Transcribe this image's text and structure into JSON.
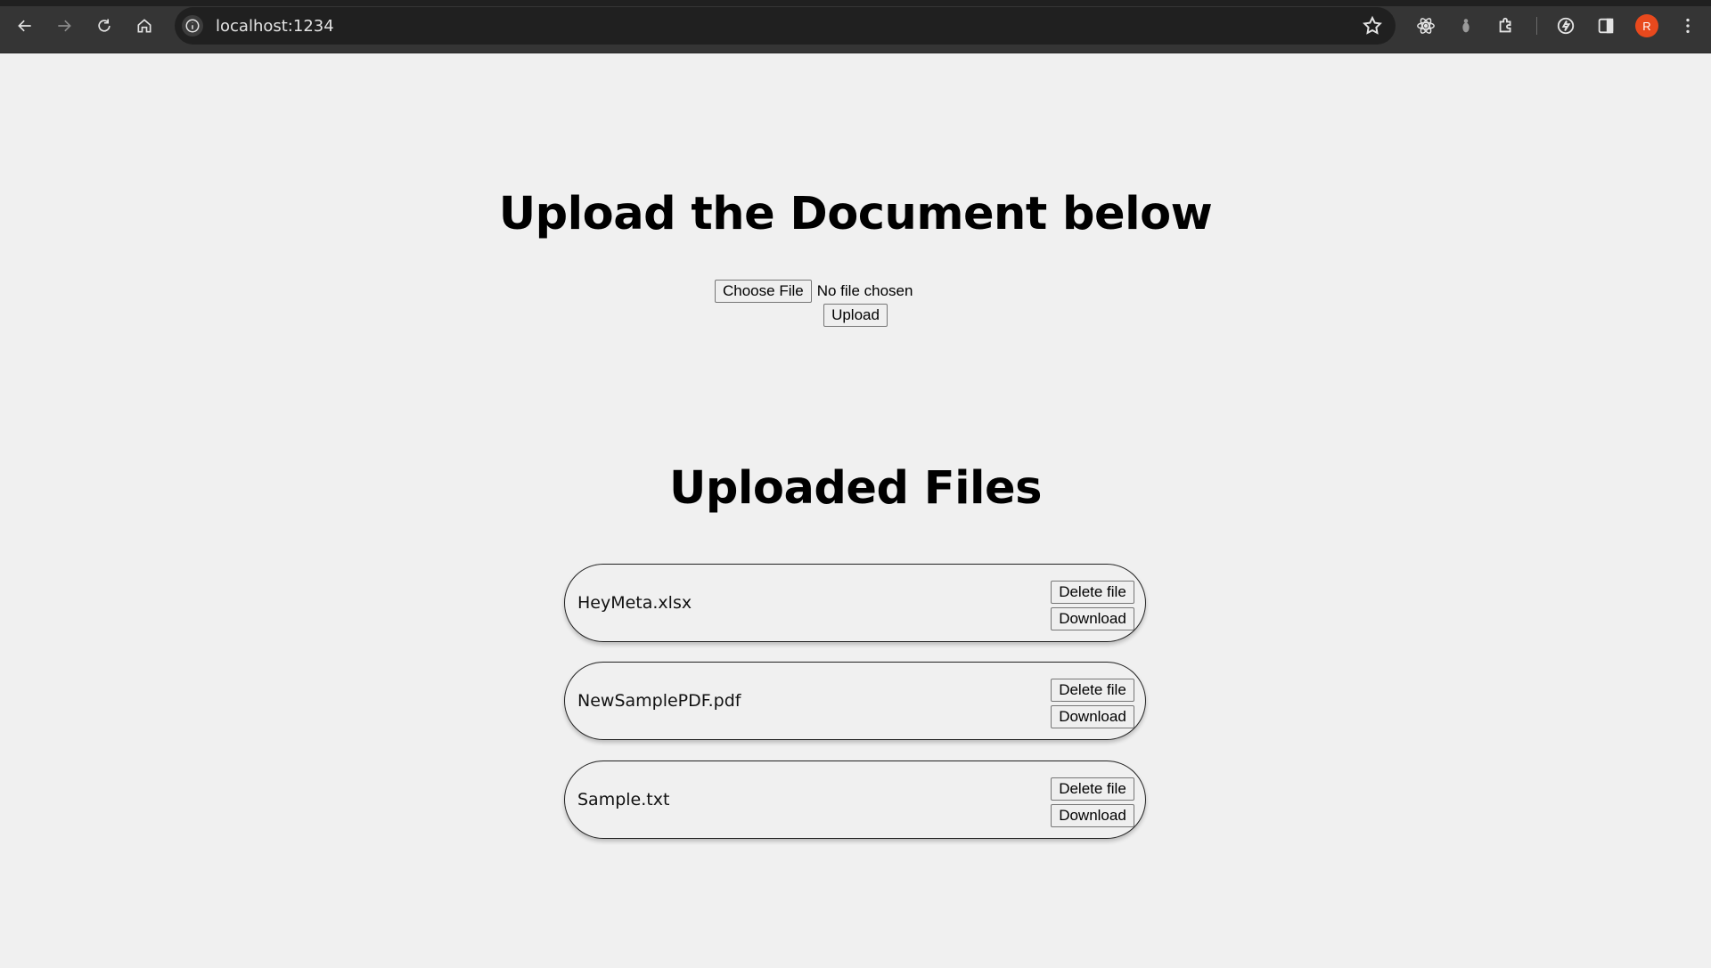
{
  "browser": {
    "url": "localhost:1234",
    "profile_initial": "R",
    "accent_color": "#e8491d",
    "icons": [
      "back-icon",
      "forward-icon",
      "reload-icon",
      "home-icon",
      "site-info-icon",
      "bookmark-star-icon",
      "react-devtools-icon",
      "extension-icon",
      "puzzle-extensions-icon",
      "performance-icon",
      "side-panel-icon",
      "menu-icon"
    ]
  },
  "upload": {
    "title": "Upload the Document below",
    "choose_file_label": "Choose File",
    "file_status": "No file chosen",
    "upload_label": "Upload"
  },
  "files": {
    "title": "Uploaded Files",
    "items": [
      {
        "name": "HeyMeta.xlsx",
        "delete_label": "Delete file",
        "download_label": "Download"
      },
      {
        "name": "NewSamplePDF.pdf",
        "delete_label": "Delete file",
        "download_label": "Download"
      },
      {
        "name": "Sample.txt",
        "delete_label": "Delete file",
        "download_label": "Download"
      }
    ]
  }
}
